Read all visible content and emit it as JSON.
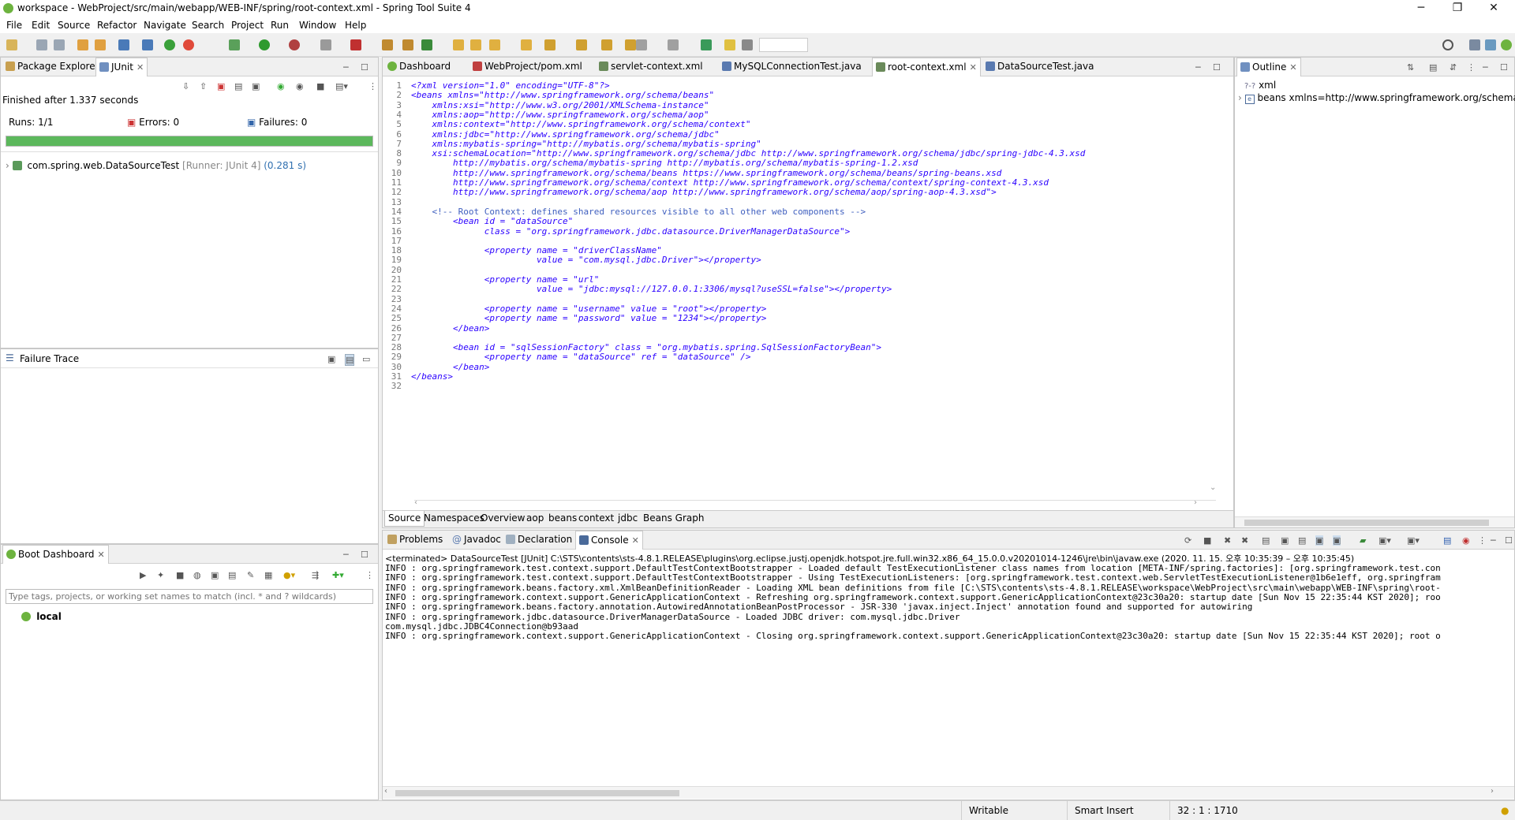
{
  "window": {
    "title": "workspace - WebProject/src/main/webapp/WEB-INF/spring/root-context.xml - Spring Tool Suite 4",
    "minimize": "─",
    "restore": "❐",
    "close": "✕"
  },
  "menu": [
    "File",
    "Edit",
    "Source",
    "Refactor",
    "Navigate",
    "Search",
    "Project",
    "Run",
    "Window",
    "Help"
  ],
  "left_top": {
    "tabs": [
      "Package Explorer",
      "JUnit"
    ],
    "finished": "Finished after 1.337 seconds",
    "runs_label": "Runs:",
    "runs_value": "1/1",
    "errors_label": "Errors:",
    "errors_value": "0",
    "failures_label": "Failures:",
    "failures_value": "0",
    "progress": 1.0,
    "test_name": "com.spring.web.DataSourceTest",
    "test_runner": "[Runner: JUnit 4]",
    "test_time": "(0.281 s)"
  },
  "failure_trace": {
    "title": "Failure Trace"
  },
  "boot_dashboard": {
    "title": "Boot Dashboard",
    "filter_placeholder": "Type tags, projects, or working set names to match (incl. * and ? wildcards)",
    "item": "local"
  },
  "editor": {
    "tabs": [
      "Dashboard",
      "WebProject/pom.xml",
      "servlet-context.xml",
      "MySQLConnectionTest.java",
      "root-context.xml",
      "DataSourceTest.java"
    ],
    "active_tab": "root-context.xml",
    "lines": [
      "<?xml version=\"1.0\" encoding=\"UTF-8\"?>",
      "<beans xmlns=\"http://www.springframework.org/schema/beans\"",
      "    xmlns:xsi=\"http://www.w3.org/2001/XMLSchema-instance\"",
      "    xmlns:aop=\"http://www.springframework.org/schema/aop\"",
      "    xmlns:context=\"http://www.springframework.org/schema/context\"",
      "    xmlns:jdbc=\"http://www.springframework.org/schema/jdbc\"",
      "    xmlns:mybatis-spring=\"http://mybatis.org/schema/mybatis-spring\"",
      "    xsi:schemaLocation=\"http://www.springframework.org/schema/jdbc http://www.springframework.org/schema/jdbc/spring-jdbc-4.3.xsd",
      "        http://mybatis.org/schema/mybatis-spring http://mybatis.org/schema/mybatis-spring-1.2.xsd",
      "        http://www.springframework.org/schema/beans https://www.springframework.org/schema/beans/spring-beans.xsd",
      "        http://www.springframework.org/schema/context http://www.springframework.org/schema/context/spring-context-4.3.xsd",
      "        http://www.springframework.org/schema/aop http://www.springframework.org/schema/aop/spring-aop-4.3.xsd\">",
      "",
      "    <!-- Root Context: defines shared resources visible to all other web components -->",
      "        <bean id = \"dataSource\"",
      "              class = \"org.springframework.jdbc.datasource.DriverManagerDataSource\">",
      "",
      "              <property name = \"driverClassName\"",
      "                        value = \"com.mysql.jdbc.Driver\"></property>",
      "",
      "              <property name = \"url\"",
      "                        value = \"jdbc:mysql://127.0.0.1:3306/mysql?useSSL=false\"></property>",
      "",
      "              <property name = \"username\" value = \"root\"></property>",
      "              <property name = \"password\" value = \"1234\"></property>",
      "        </bean>",
      "",
      "        <bean id = \"sqlSessionFactory\" class = \"org.mybatis.spring.SqlSessionFactoryBean\">",
      "              <property name = \"dataSource\" ref = \"dataSource\" />",
      "        </bean>",
      "</beans>",
      ""
    ],
    "bottom_tabs": [
      "Source",
      "Namespaces",
      "Overview",
      "aop",
      "beans",
      "context",
      "jdbc",
      "Beans Graph"
    ]
  },
  "outline": {
    "title": "Outline",
    "items": [
      "xml",
      "beans xmlns=http://www.springframework.org/schema/be"
    ]
  },
  "console": {
    "tabs": [
      "Problems",
      "Javadoc",
      "Declaration",
      "Console"
    ],
    "terminated": "<terminated> DataSourceTest [JUnit] C:\\STS\\contents\\sts-4.8.1.RELEASE\\plugins\\org.eclipse.justj.openjdk.hotspot.jre.full.win32.x86_64_15.0.0.v20201014-1246\\jre\\bin\\javaw.exe  (2020. 11. 15. 오후 10:35:39 – 오후 10:35:45)",
    "lines": [
      "INFO : org.springframework.test.context.support.DefaultTestContextBootstrapper - Loaded default TestExecutionListener class names from location [META-INF/spring.factories]: [org.springframework.test.con",
      "INFO : org.springframework.test.context.support.DefaultTestContextBootstrapper - Using TestExecutionListeners: [org.springframework.test.context.web.ServletTestExecutionListener@1b6e1eff, org.springfram",
      "INFO : org.springframework.beans.factory.xml.XmlBeanDefinitionReader - Loading XML bean definitions from file [C:\\STS\\contents\\sts-4.8.1.RELEASE\\workspace\\WebProject\\src\\main\\webapp\\WEB-INF\\spring\\root-",
      "INFO : org.springframework.context.support.GenericApplicationContext - Refreshing org.springframework.context.support.GenericApplicationContext@23c30a20: startup date [Sun Nov 15 22:35:44 KST 2020]; roo",
      "INFO : org.springframework.beans.factory.annotation.AutowiredAnnotationBeanPostProcessor - JSR-330 'javax.inject.Inject' annotation found and supported for autowiring",
      "INFO : org.springframework.jdbc.datasource.DriverManagerDataSource - Loaded JDBC driver: com.mysql.jdbc.Driver",
      "com.mysql.jdbc.JDBC4Connection@b93aad",
      "INFO : org.springframework.context.support.GenericApplicationContext - Closing org.springframework.context.support.GenericApplicationContext@23c30a20: startup date [Sun Nov 15 22:35:44 KST 2020]; root o"
    ]
  },
  "status": {
    "writable": "Writable",
    "insert": "Smart Insert",
    "position": "32 : 1 : 1710"
  },
  "colors": {
    "progress_green": "#5cb85c",
    "spring_green": "#6db33f",
    "xml_string": "#2a00ff",
    "xml_tag": "#3f7f7f",
    "comment": "#3f5fbf"
  }
}
